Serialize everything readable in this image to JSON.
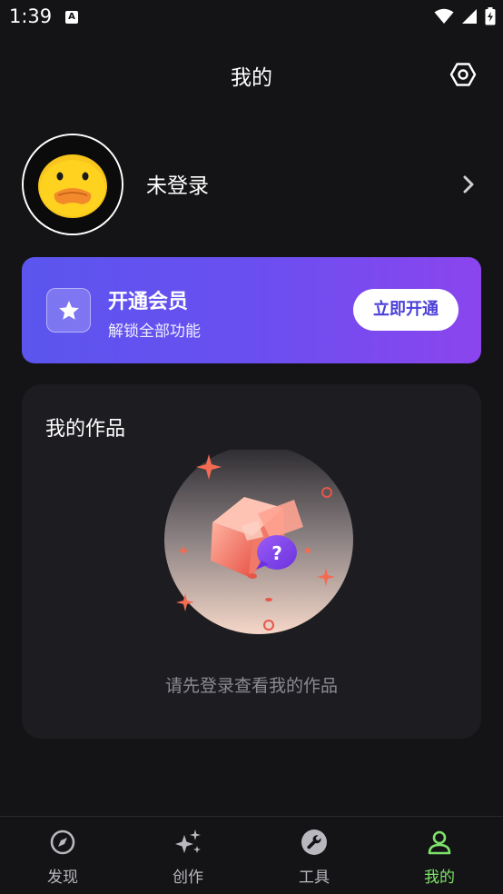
{
  "status_bar": {
    "time": "1:39",
    "notification_letter": "A"
  },
  "header": {
    "title": "我的",
    "settings_icon": "settings-hexagon-icon"
  },
  "profile": {
    "login_status": "未登录",
    "avatar_icon": "duck-avatar-icon"
  },
  "vip": {
    "title": "开通会员",
    "subtitle": "解锁全部功能",
    "button": "立即开通",
    "icon": "star-icon",
    "colors": {
      "start": "#5b55ee",
      "end": "#8b45ee"
    }
  },
  "works": {
    "title": "我的作品",
    "empty_text": "请先登录查看我的作品",
    "illustration_icon": "empty-box-question-icon"
  },
  "nav": {
    "items": [
      {
        "label": "发现",
        "icon": "compass-icon"
      },
      {
        "label": "创作",
        "icon": "sparkle-icon"
      },
      {
        "label": "工具",
        "icon": "wrench-icon"
      },
      {
        "label": "我的",
        "icon": "person-icon"
      }
    ],
    "active_index": 3,
    "active_color": "#7fe36a"
  }
}
